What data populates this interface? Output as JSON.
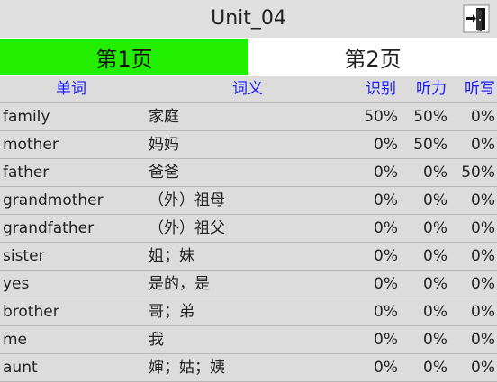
{
  "header": {
    "title": "Unit_04",
    "exit_icon": "door-exit-icon"
  },
  "tabs": [
    {
      "label": "第1页",
      "active": true
    },
    {
      "label": "第2页",
      "active": false
    }
  ],
  "colors": {
    "active_tab": "#22ee00",
    "header_text": "#1a1aff",
    "background": "#dcdcdc"
  },
  "table": {
    "columns": {
      "word": "单词",
      "meaning": "词义",
      "recognition": "识别",
      "listening": "听力",
      "dictation": "听写"
    },
    "rows": [
      {
        "word": "family",
        "meaning": "家庭",
        "recognition": "50%",
        "listening": "50%",
        "dictation": "0%"
      },
      {
        "word": "mother",
        "meaning": "妈妈",
        "recognition": "0%",
        "listening": "50%",
        "dictation": "0%"
      },
      {
        "word": "father",
        "meaning": "爸爸",
        "recognition": "0%",
        "listening": "0%",
        "dictation": "50%"
      },
      {
        "word": "grandmother",
        "meaning": "（外）祖母",
        "recognition": "0%",
        "listening": "0%",
        "dictation": "0%"
      },
      {
        "word": "grandfather",
        "meaning": "（外）祖父",
        "recognition": "0%",
        "listening": "0%",
        "dictation": "0%"
      },
      {
        "word": "sister",
        "meaning": "姐；妹",
        "recognition": "0%",
        "listening": "0%",
        "dictation": "0%"
      },
      {
        "word": "yes",
        "meaning": "是的，是",
        "recognition": "0%",
        "listening": "0%",
        "dictation": "0%"
      },
      {
        "word": "brother",
        "meaning": "哥；弟",
        "recognition": "0%",
        "listening": "0%",
        "dictation": "0%"
      },
      {
        "word": "me",
        "meaning": "我",
        "recognition": "0%",
        "listening": "0%",
        "dictation": "0%"
      },
      {
        "word": "aunt",
        "meaning": "婶；姑；姨",
        "recognition": "0%",
        "listening": "0%",
        "dictation": "0%"
      }
    ]
  }
}
